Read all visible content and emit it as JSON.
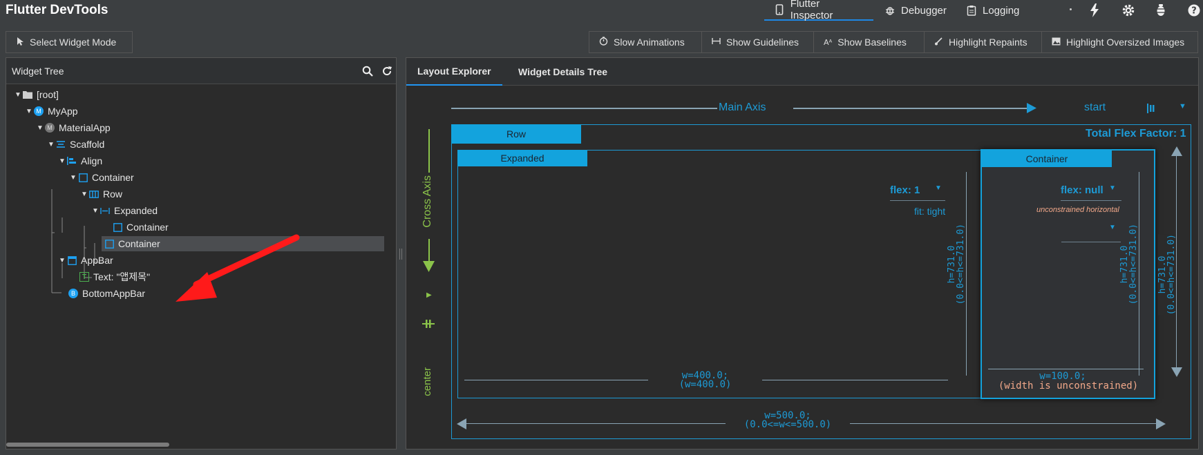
{
  "app": {
    "title": "Flutter DevTools"
  },
  "nav": {
    "tabs": [
      {
        "label": "Flutter Inspector",
        "icon": "phone-icon"
      },
      {
        "label": "Debugger",
        "icon": "bug-icon"
      },
      {
        "label": "Logging",
        "icon": "clipboard-icon"
      }
    ]
  },
  "toolbar": {
    "select_widget_mode": "Select Widget Mode",
    "slow_animations": "Slow Animations",
    "show_guidelines": "Show Guidelines",
    "show_baselines": "Show Baselines",
    "highlight_repaints": "Highlight Repaints",
    "highlight_oversized_images": "Highlight Oversized Images"
  },
  "widget_tree": {
    "title": "Widget Tree",
    "nodes": [
      {
        "label": "[root]"
      },
      {
        "label": "MyApp"
      },
      {
        "label": "MaterialApp"
      },
      {
        "label": "Scaffold"
      },
      {
        "label": "Align"
      },
      {
        "label": "Container"
      },
      {
        "label": "Row"
      },
      {
        "label": "Expanded"
      },
      {
        "label": "Container"
      },
      {
        "label": "Container"
      },
      {
        "label": "AppBar"
      },
      {
        "label": "Text: \"앱제목\""
      },
      {
        "label": "BottomAppBar"
      }
    ]
  },
  "right_tabs": {
    "layout_explorer": "Layout Explorer",
    "widget_details": "Widget Details Tree"
  },
  "layout": {
    "main_axis": "Main Axis",
    "main_axis_alignment": "start",
    "cross_axis": "Cross Axis",
    "cross_axis_alignment": "center",
    "total_flex": "Total Flex Factor: 1",
    "row_label": "Row",
    "expanded_label": "Expanded",
    "container_label": "Container",
    "expanded_flex": "flex: 1",
    "expanded_fit": "fit: tight",
    "container_flex": "flex: null",
    "container_note": "unconstrained horizontal",
    "expanded_h": "h=731.0",
    "expanded_h_constraint": "(0.0<=h<=731.0)",
    "container_h": "h=731.0",
    "container_h_constraint": "(0.0<=h<=731.0)",
    "row_h": "h=731.0",
    "row_h_constraint": "(0.0<=h<=731.0)",
    "expanded_w": "w=400.0;",
    "expanded_w_constraint": "(w=400.0)",
    "container_w": "w=100.0;",
    "container_w_note": "(width is unconstrained)",
    "row_w": "w=500.0;",
    "row_w_constraint": "(0.0<=w<=500.0)"
  },
  "colors": {
    "accent": "#1d9bd6",
    "cross_axis": "#8bc34a",
    "arrow": "#ff0000"
  }
}
